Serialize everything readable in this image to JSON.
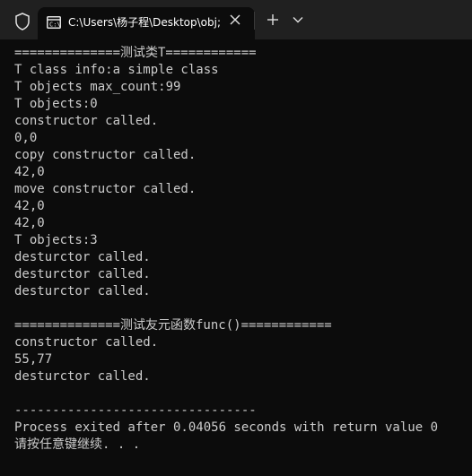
{
  "tab": {
    "title": "C:\\Users\\杨子程\\Desktop\\obj;",
    "close_icon": "close-icon",
    "new_tab_icon": "plus-icon",
    "dropdown_icon": "chevron-down-icon",
    "shield_icon": "shield-icon",
    "terminal_icon": "terminal-icon"
  },
  "console": {
    "lines": [
      "==============测试类T============",
      "T class info:a simple class",
      "T objects max_count:99",
      "T objects:0",
      "constructor called.",
      "0,0",
      "copy constructor called.",
      "42,0",
      "move constructor called.",
      "42,0",
      "42,0",
      "T objects:3",
      "desturctor called.",
      "desturctor called.",
      "desturctor called.",
      "",
      "==============测试友元函数func()============",
      "constructor called.",
      "55,77",
      "desturctor called.",
      "",
      "--------------------------------",
      "Process exited after 0.04056 seconds with return value 0",
      "请按任意键继续. . ."
    ]
  },
  "colors": {
    "background": "#0c0c0c",
    "titlebar": "#202020",
    "text": "#cccccc"
  }
}
